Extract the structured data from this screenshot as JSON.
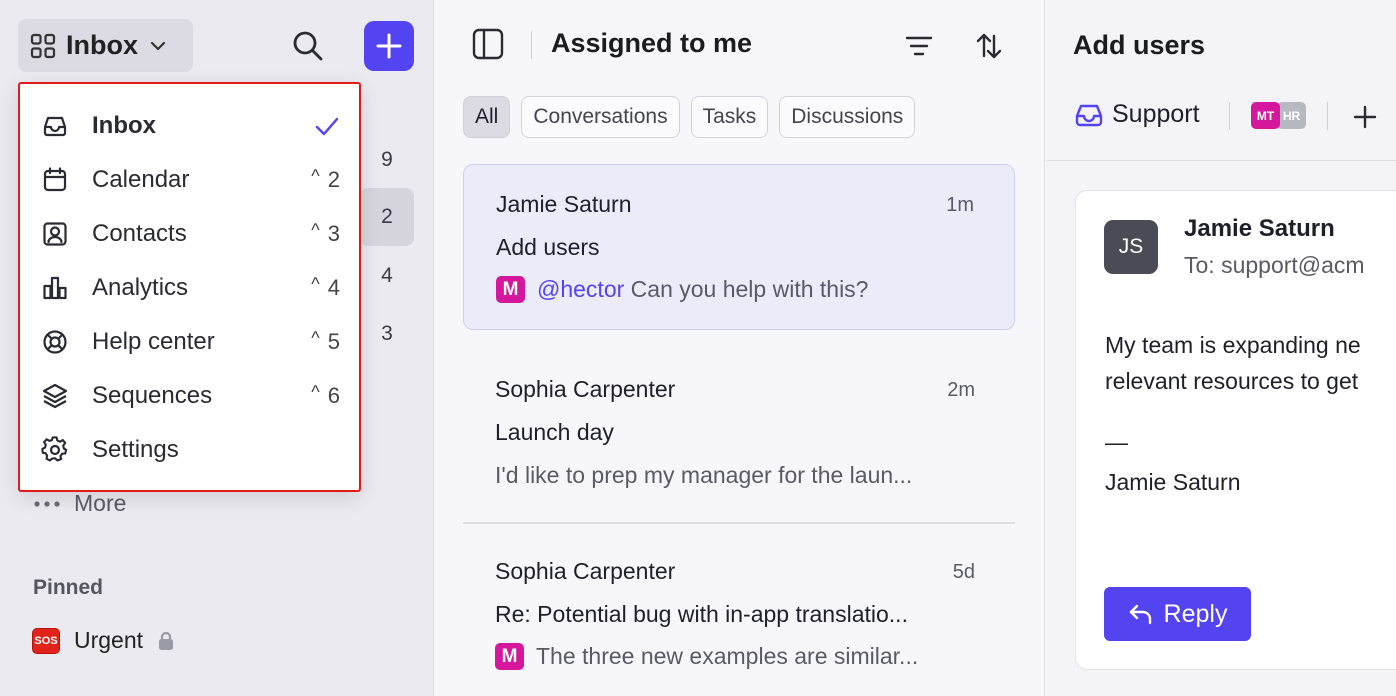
{
  "sidebar": {
    "workspace_label": "Inbox",
    "bg_counts": [
      "9",
      "2",
      "4",
      "3"
    ],
    "more_label": "More",
    "pinned_title": "Pinned",
    "pinned_items": [
      {
        "label": "Urgent",
        "badge": "SOS"
      }
    ],
    "accent_color": "#5443f0"
  },
  "dropdown": {
    "items": [
      {
        "label": "Inbox",
        "icon": "inbox-icon",
        "checked": true,
        "shortcut": ""
      },
      {
        "label": "Calendar",
        "icon": "calendar-icon",
        "shortcut": "2"
      },
      {
        "label": "Contacts",
        "icon": "contacts-icon",
        "shortcut": "3"
      },
      {
        "label": "Analytics",
        "icon": "analytics-icon",
        "shortcut": "4"
      },
      {
        "label": "Help center",
        "icon": "lifebuoy-icon",
        "shortcut": "5"
      },
      {
        "label": "Sequences",
        "icon": "layers-icon",
        "shortcut": "6"
      },
      {
        "label": "Settings",
        "icon": "gear-icon",
        "shortcut": ""
      }
    ],
    "shortcut_modifier": "^"
  },
  "list": {
    "title": "Assigned to me",
    "filters": [
      "All",
      "Conversations",
      "Tasks",
      "Discussions"
    ],
    "active_filter": "All",
    "conversations": [
      {
        "name": "Jamie Saturn",
        "time": "1m",
        "subject": "Add users",
        "badge": "M",
        "mention": "@hector",
        "preview": "Can you help with this?"
      },
      {
        "name": "Sophia Carpenter",
        "time": "2m",
        "subject": "Launch day",
        "preview": "I'd like to prep my manager for the laun..."
      },
      {
        "name": "Sophia Carpenter",
        "time": "5d",
        "subject": "Re: Potential bug with in-app translatio...",
        "badge": "M",
        "preview": "The three new examples are similar..."
      }
    ]
  },
  "detail": {
    "title": "Add users",
    "inbox_tag": "Support",
    "assignees": [
      "MT",
      "HR"
    ],
    "message": {
      "avatar": "JS",
      "sender": "Jamie Saturn",
      "to": "To: support@acm",
      "body_line1": "My team is expanding ne",
      "body_line2": "relevant resources to get",
      "sig_dash": "—",
      "sig_name": "Jamie Saturn"
    },
    "reply_label": "Reply"
  }
}
